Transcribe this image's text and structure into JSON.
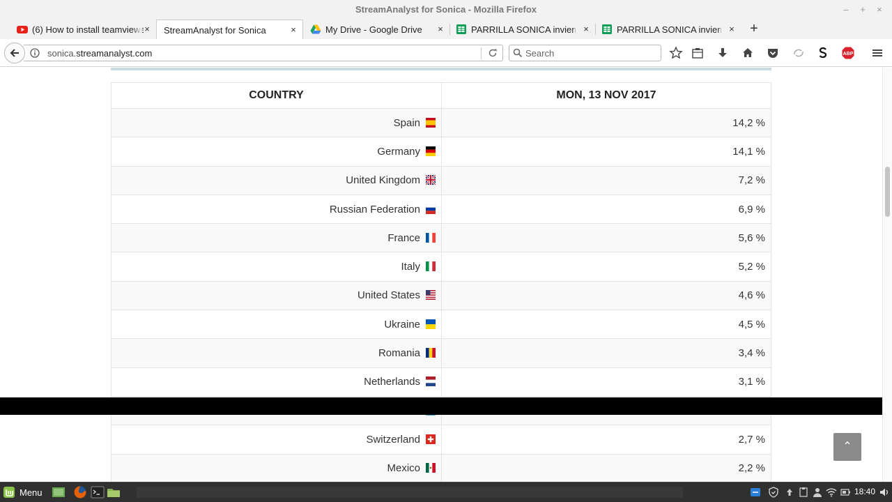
{
  "window": {
    "title": "StreamAnalyst for Sonica - Mozilla Firefox",
    "minimize": "–",
    "maximize": "+",
    "close": "×"
  },
  "tabs": [
    {
      "label": "(6) How to install teamviewe",
      "icon": "youtube-icon",
      "active": false
    },
    {
      "label": "StreamAnalyst for Sonica",
      "icon": "none",
      "active": true
    },
    {
      "label": "My Drive - Google Drive",
      "icon": "google-drive-icon",
      "active": false
    },
    {
      "label": "PARRILLA SONICA invierno",
      "icon": "google-sheets-icon",
      "active": false
    },
    {
      "label": "PARRILLA SONICA invierno",
      "icon": "google-sheets-icon",
      "active": false
    }
  ],
  "new_tab": "+",
  "tab_close": "×",
  "nav": {
    "url_prefix": "sonica.",
    "url_domain": "streamanalyst.com",
    "search_placeholder": "Search"
  },
  "table": {
    "headers": {
      "country": "COUNTRY",
      "date": "MON, 13 NOV 2017"
    },
    "rows": [
      {
        "country": "Spain",
        "value": "14,2 %",
        "flag": "spain-flag"
      },
      {
        "country": "Germany",
        "value": "14,1 %",
        "flag": "germany-flag"
      },
      {
        "country": "United Kingdom",
        "value": "7,2 %",
        "flag": "uk-flag"
      },
      {
        "country": "Russian Federation",
        "value": "6,9 %",
        "flag": "russia-flag"
      },
      {
        "country": "France",
        "value": "5,6 %",
        "flag": "france-flag"
      },
      {
        "country": "Italy",
        "value": "5,2 %",
        "flag": "italy-flag"
      },
      {
        "country": "United States",
        "value": "4,6 %",
        "flag": "usa-flag"
      },
      {
        "country": "Ukraine",
        "value": "4,5 %",
        "flag": "ukraine-flag"
      },
      {
        "country": "Romania",
        "value": "3,4 %",
        "flag": "romania-flag"
      },
      {
        "country": "Netherlands",
        "value": "3,1 %",
        "flag": "netherlands-flag"
      },
      {
        "country": "",
        "value": "",
        "flag": "obscured-flag"
      },
      {
        "country": "Switzerland",
        "value": "2,7 %",
        "flag": "switzerland-flag"
      },
      {
        "country": "Mexico",
        "value": "2,2 %",
        "flag": "mexico-flag"
      }
    ]
  },
  "back_to_top": "⌃",
  "taskbar": {
    "menu_label": "Menu",
    "clock": "18:40"
  }
}
